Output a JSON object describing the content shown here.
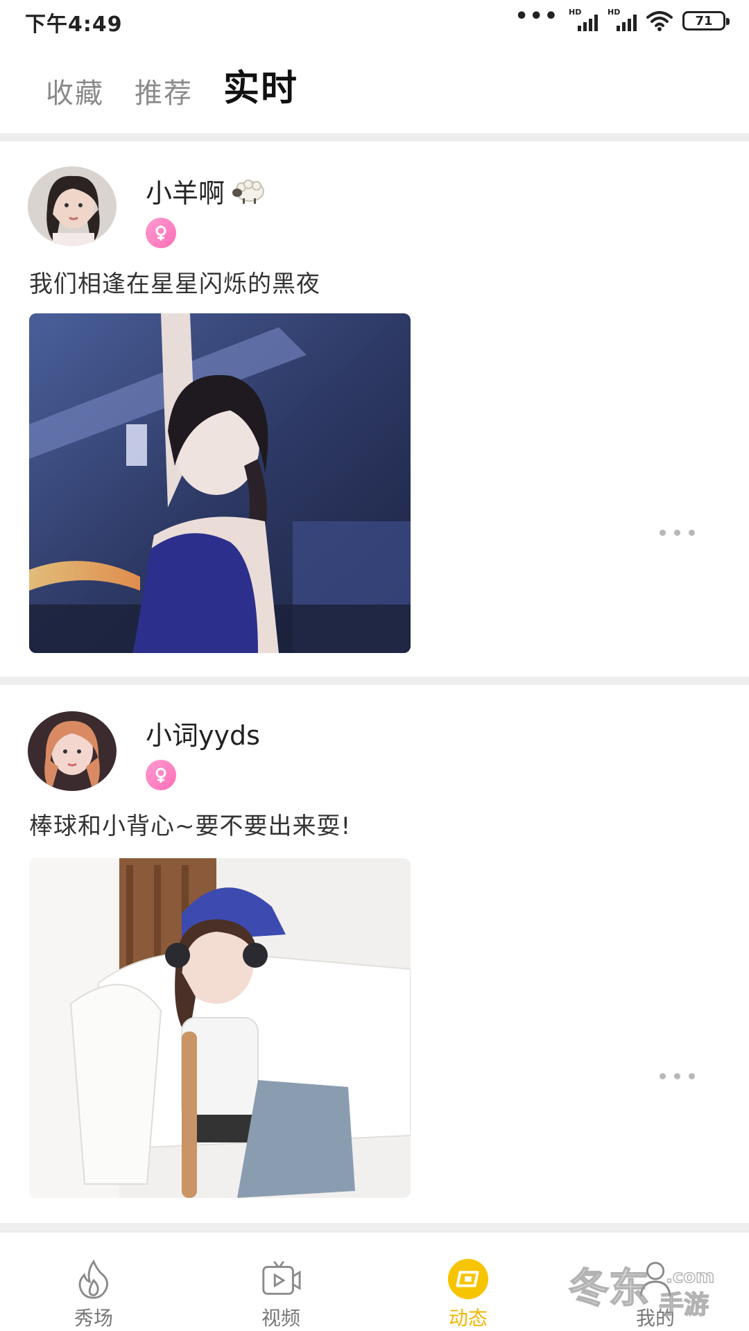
{
  "status_bar": {
    "time": "下午4:49",
    "signal1_label": "HD",
    "signal2_label": "HD",
    "battery": "71"
  },
  "top_tabs": [
    {
      "label": "收藏",
      "active": false
    },
    {
      "label": "推荐",
      "active": false
    },
    {
      "label": "实时",
      "active": true
    }
  ],
  "posts": [
    {
      "user_name": "小羊啊",
      "name_icon": "sheep-icon",
      "gender": "female",
      "text": "我们相逢在星星闪烁的黑夜",
      "photo": "photo-girl-blue-swimsuit"
    },
    {
      "user_name": "小词yyds",
      "gender": "female",
      "text": "棒球和小背心~要不要出来耍!",
      "photo": "photo-girl-baseball-helmet"
    }
  ],
  "bottom_nav": [
    {
      "label": "秀场",
      "icon": "flame-icon",
      "active": false
    },
    {
      "label": "视频",
      "icon": "video-tv-icon",
      "active": false
    },
    {
      "label": "动态",
      "icon": "feed-icon",
      "active": true
    },
    {
      "label": "我的",
      "icon": "person-icon",
      "active": false
    }
  ],
  "watermark": {
    "text": "冬东手游",
    "domain": ".com"
  },
  "colors": {
    "accent_yellow": "#f2b600",
    "tab_underline": "#ff3d6b",
    "gender_badge": "#ff6fb6",
    "divider": "#eeeeee"
  }
}
